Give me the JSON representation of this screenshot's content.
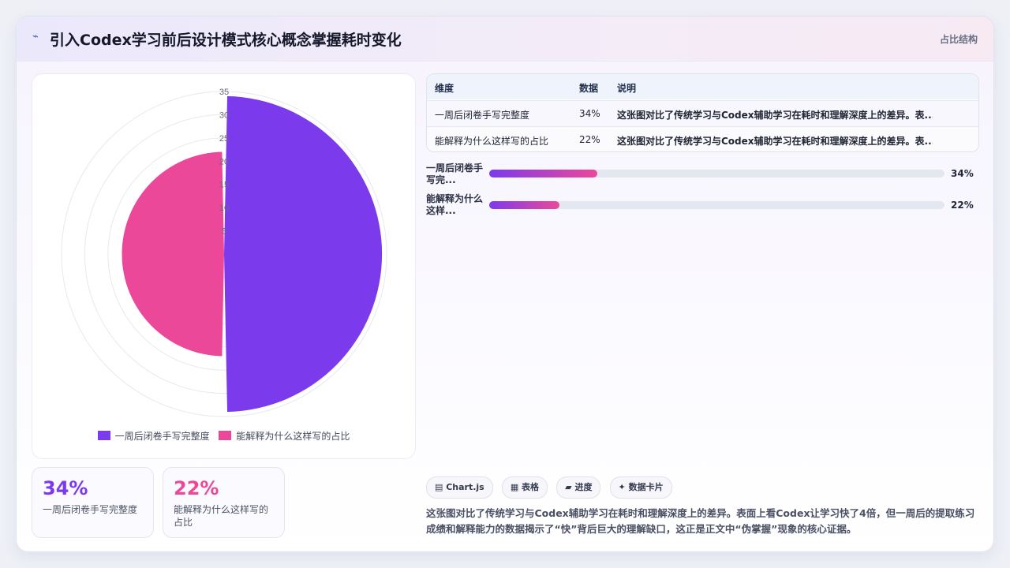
{
  "header": {
    "logo": "⌁",
    "title": "引入Codex学习前后设计模式核心概念掌握耗时变化",
    "tag": "占比结构"
  },
  "chart_data": {
    "type": "polar-area",
    "categories": [
      "一周后闭卷手写完整度",
      "能解释为什么这样写的占比"
    ],
    "values": [
      34,
      22
    ],
    "colors": [
      "#7c3aed",
      "#ec4899"
    ],
    "r_ticks": [
      "35",
      "30",
      "25",
      "20",
      "15",
      "10",
      "5"
    ],
    "r_max": 35,
    "legend": [
      "一周后闭卷手写完整度",
      "能解释为什么这样写的占比"
    ]
  },
  "stats": [
    {
      "value": "34%",
      "label": "一周后闭卷手写完整度",
      "color": "#7c3aed"
    },
    {
      "value": "22%",
      "label": "能解释为什么这样写的占比",
      "color": "#ec4899"
    }
  ],
  "table": {
    "headers": [
      "维度",
      "数据",
      "说明"
    ],
    "rows": [
      [
        "一周后闭卷手写完整度",
        "34%",
        "这张图对比了传统学习与Codex辅助学习在耗时和理解深度上的差异。表..."
      ],
      [
        "能解释为什么这样写的占比",
        "22%",
        "这张图对比了传统学习与Codex辅助学习在耗时和理解深度上的差异。表..."
      ]
    ]
  },
  "progress": [
    {
      "label": "一周后闭卷手写完...",
      "value": 34,
      "text": "34%"
    },
    {
      "label": "能解释为什么这样...",
      "value": 22,
      "text": "22%"
    }
  ],
  "chips": [
    "▤ Chart.js",
    "▦ 表格",
    "▰ 进度",
    "✦ 数据卡片"
  ],
  "description": "这张图对比了传统学习与Codex辅助学习在耗时和理解深度上的差异。表面上看Codex让学习快了4倍，但一周后的提取练习成绩和解释能力的数据揭示了“快”背后巨大的理解缺口，这正是正文中“伪掌握”现象的核心证据。"
}
